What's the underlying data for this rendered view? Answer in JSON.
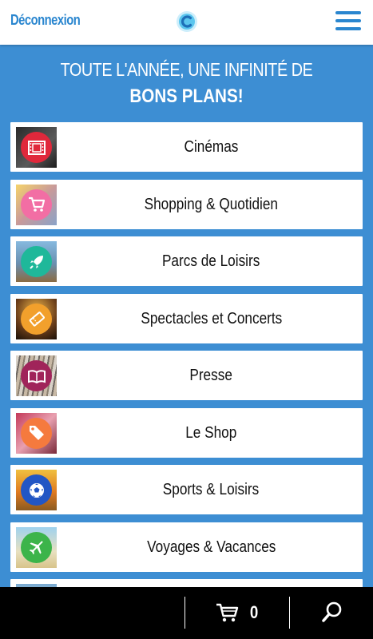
{
  "header": {
    "logout_label": "Déconnexion",
    "logo_icon": "app-logo-icon",
    "menu_icon": "hamburger-menu-icon",
    "accent_color": "#2a86cf"
  },
  "headline": {
    "line1": "TOUTE L'ANNÉE, UNE INFINITÉ DE",
    "line2": "BONS PLANS!"
  },
  "categories": [
    {
      "label": "Cinémas",
      "icon": "film-icon",
      "color": "#e0283b"
    },
    {
      "label": "Shopping & Quotidien",
      "icon": "cart-icon",
      "color": "#f26ea4"
    },
    {
      "label": "Parcs de Loisirs",
      "icon": "rocket-icon",
      "color": "#1fb89a"
    },
    {
      "label": "Spectacles et Concerts",
      "icon": "ticket-icon",
      "color": "#f2a02c"
    },
    {
      "label": "Presse",
      "icon": "book-icon",
      "color": "#a0245a"
    },
    {
      "label": "Le Shop",
      "icon": "tag-icon",
      "color": "#f57a3e"
    },
    {
      "label": "Sports & Loisirs",
      "icon": "soccer-ball-icon",
      "color": "#2256c4"
    },
    {
      "label": "Voyages & Vacances",
      "icon": "airplane-icon",
      "color": "#3cb44a"
    }
  ],
  "bottom_bar": {
    "cart_icon": "cart-icon",
    "cart_count": "0",
    "search_icon": "search-icon"
  }
}
